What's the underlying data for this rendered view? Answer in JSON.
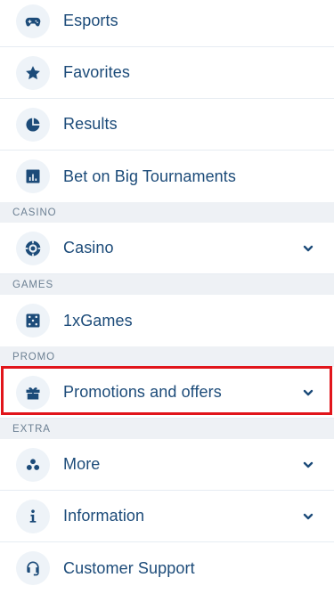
{
  "menu": {
    "items": {
      "esports": {
        "label": "Esports",
        "icon": "gamepad-icon"
      },
      "favorites": {
        "label": "Favorites",
        "icon": "star-icon"
      },
      "results": {
        "label": "Results",
        "icon": "pie-chart-icon"
      },
      "big_tournaments": {
        "label": "Bet on Big Tournaments",
        "icon": "bar-chart-icon"
      },
      "casino": {
        "label": "Casino",
        "icon": "casino-chip-icon"
      },
      "onexgames": {
        "label": "1xGames",
        "icon": "dice-icon"
      },
      "promotions": {
        "label": "Promotions and offers",
        "icon": "gift-icon"
      },
      "more": {
        "label": "More",
        "icon": "dots-cluster-icon"
      },
      "information": {
        "label": "Information",
        "icon": "info-icon"
      },
      "support": {
        "label": "Customer Support",
        "icon": "headset-icon"
      }
    },
    "sections": {
      "casino": "CASINO",
      "games": "GAMES",
      "promo": "PROMO",
      "extra": "EXTRA"
    }
  },
  "colors": {
    "text": "#1c4b79",
    "section_bg": "#eef1f5",
    "section_text": "#6b7f92",
    "highlight": "#e1151b"
  }
}
